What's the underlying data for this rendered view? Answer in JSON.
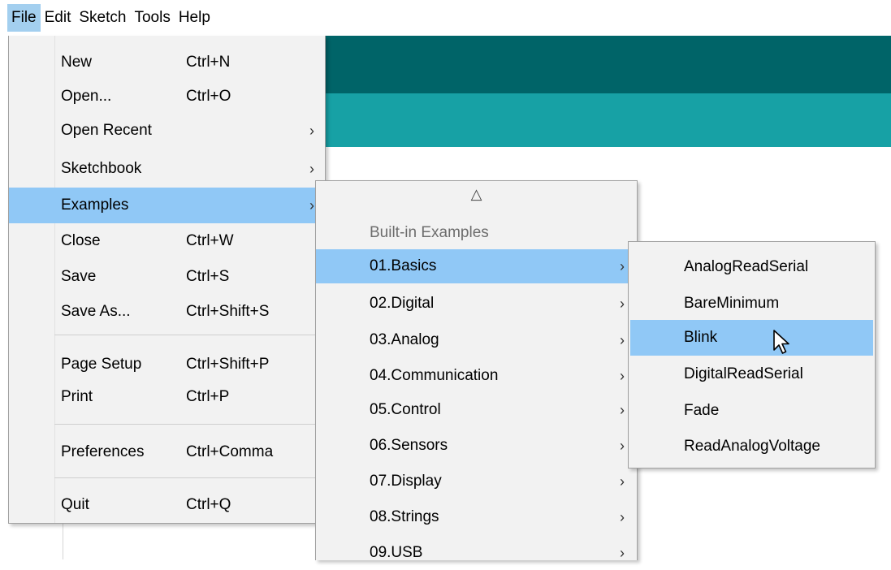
{
  "menubar": [
    "File",
    "Edit",
    "Sketch",
    "Tools",
    "Help"
  ],
  "file_menu": {
    "items": [
      {
        "label": "New",
        "shortcut": "Ctrl+N"
      },
      {
        "label": "Open...",
        "shortcut": "Ctrl+O"
      },
      {
        "label": "Open Recent",
        "submenu": true
      },
      {
        "label": "Sketchbook",
        "submenu": true
      },
      {
        "label": "Examples",
        "submenu": true,
        "highlighted": true
      },
      {
        "label": "Close",
        "shortcut": "Ctrl+W"
      },
      {
        "label": "Save",
        "shortcut": "Ctrl+S"
      },
      {
        "label": "Save As...",
        "shortcut": "Ctrl+Shift+S"
      },
      {
        "label": "Page Setup",
        "shortcut": "Ctrl+Shift+P"
      },
      {
        "label": "Print",
        "shortcut": "Ctrl+P"
      },
      {
        "label": "Preferences",
        "shortcut": "Ctrl+Comma"
      },
      {
        "label": "Quit",
        "shortcut": "Ctrl+Q"
      }
    ]
  },
  "examples_menu": {
    "scroll_up_glyph": "△",
    "header": "Built-in Examples",
    "items": [
      {
        "label": "01.Basics",
        "highlighted": true
      },
      {
        "label": "02.Digital"
      },
      {
        "label": "03.Analog"
      },
      {
        "label": "04.Communication"
      },
      {
        "label": "05.Control"
      },
      {
        "label": "06.Sensors"
      },
      {
        "label": "07.Display"
      },
      {
        "label": "08.Strings"
      },
      {
        "label": "09.USB"
      }
    ]
  },
  "basics_menu": {
    "items": [
      {
        "label": "AnalogReadSerial"
      },
      {
        "label": "BareMinimum"
      },
      {
        "label": "Blink",
        "highlighted": true
      },
      {
        "label": "DigitalReadSerial"
      },
      {
        "label": "Fade"
      },
      {
        "label": "ReadAnalogVoltage"
      }
    ]
  },
  "arrow_glyph": "›",
  "icons": {
    "cursor": "mouse-pointer-icon",
    "submenu": "chevron-right-icon",
    "scroll_up": "triangle-up-icon"
  },
  "colors": {
    "highlight": "#90c8f6",
    "menubar_active": "#a3cfef",
    "header_dark": "#006468",
    "header_teal": "#17a1a5",
    "menu_bg": "#f2f2f2"
  }
}
